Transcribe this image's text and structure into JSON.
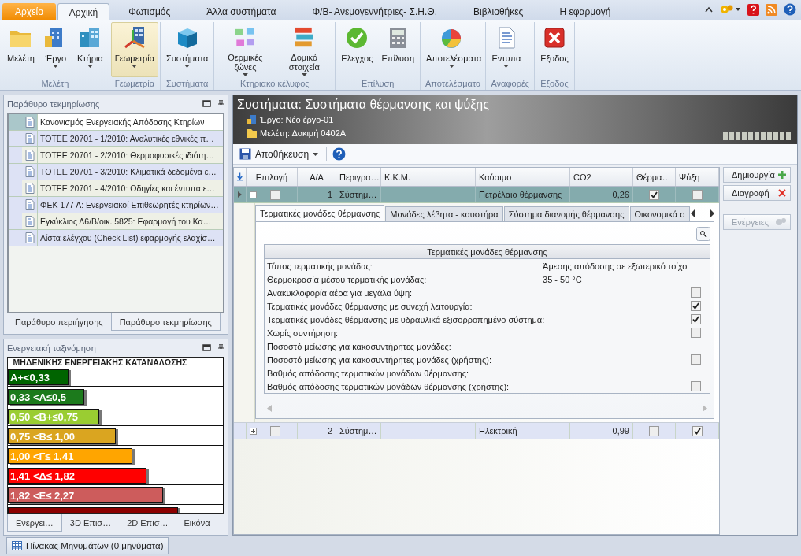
{
  "menu_tabs": [
    {
      "label": "Αρχείο",
      "kind": "app",
      "selected": false
    },
    {
      "label": "Αρχική",
      "kind": "tab",
      "selected": true
    },
    {
      "label": "Φωτισμός",
      "kind": "tab",
      "selected": false
    },
    {
      "label": "Άλλα συστήματα",
      "kind": "tab",
      "selected": false
    },
    {
      "label": "Φ/Β- Ανεμογεννήτριες- Σ.Η.Θ.",
      "kind": "tab",
      "selected": false
    },
    {
      "label": "Βιβλιοθήκες",
      "kind": "tab",
      "selected": false
    },
    {
      "label": "Η εφαρμογή",
      "kind": "tab",
      "selected": false
    }
  ],
  "ribbon": {
    "groups": [
      {
        "label": "Μελέτη",
        "buttons": [
          {
            "label": "Μελέτη",
            "dropdown": false,
            "selected": false
          },
          {
            "label": "Έργο",
            "dropdown": true,
            "selected": false
          },
          {
            "label": "Κτήρια",
            "dropdown": true,
            "selected": false
          }
        ]
      },
      {
        "label": "Γεωμετρία",
        "buttons": [
          {
            "label": "Γεωμετρία",
            "dropdown": true,
            "selected": true
          }
        ]
      },
      {
        "label": "Συστήματα",
        "buttons": [
          {
            "label": "Συστήματα",
            "dropdown": true,
            "selected": false
          }
        ]
      },
      {
        "label": "Κτηριακό κέλυφος",
        "buttons": [
          {
            "label": "Θερμικές ζώνες",
            "dropdown": true,
            "selected": false
          },
          {
            "label": "Δομικά στοιχεία",
            "dropdown": true,
            "selected": false
          }
        ]
      },
      {
        "label": "Επίλυση",
        "buttons": [
          {
            "label": "Ελεγχος",
            "dropdown": false,
            "selected": false
          },
          {
            "label": "Επίλυση",
            "dropdown": false,
            "selected": false
          }
        ]
      },
      {
        "label": "Αποτελέσματα",
        "buttons": [
          {
            "label": "Αποτελέσματα",
            "dropdown": true,
            "selected": false
          }
        ]
      },
      {
        "label": "Αναφορές",
        "buttons": [
          {
            "label": "Εντυπα",
            "dropdown": true,
            "selected": false
          }
        ]
      },
      {
        "label": "Εξοδος",
        "buttons": [
          {
            "label": "Εξοδος",
            "dropdown": false,
            "selected": false
          }
        ]
      }
    ]
  },
  "doc_panel": {
    "title": "Παράθυρο τεκμηρίωσης",
    "items": [
      {
        "text": "Κανονισμός Ενεργειακής Απόδοσης Κτηρίων",
        "selected": true
      },
      {
        "text": "ΤΟΤΕΕ 20701 - 1/2010: Αναλυτικές εθνικές π…",
        "selected": false
      },
      {
        "text": "ΤΟΤΕΕ 20701 - 2/2010: Θερμοφυσικές ιδιότη…",
        "selected": false
      },
      {
        "text": "ΤΟΤΕΕ 20701 - 3/2010: Κλιματικά δεδομένα ε…",
        "selected": false
      },
      {
        "text": "ΤΟΤΕΕ 20701 - 4/2010: Οδηγίες και έντυπα ε…",
        "selected": false
      },
      {
        "text": "ΦΕΚ 177 Α: Ενεργειακοί Επιθεωρητές κτηρίων…",
        "selected": false
      },
      {
        "text": "Εγκύκλιος Δ6/Β/οικ. 5825: Εφαρμογή του Κα…",
        "selected": false
      },
      {
        "text": "Λίστα ελέγχου (Check List) εφαρμογής ελαχίσ…",
        "selected": false
      }
    ],
    "tabs": [
      {
        "label": "Παράθυρο περιήγησης",
        "selected": false
      },
      {
        "label": "Παράθυρο τεκμηρίωσης",
        "selected": true
      }
    ]
  },
  "energy_panel": {
    "title": "Ενεργειακή ταξινόμηση",
    "header": "ΜΗΔΕΝΙΚΗΣ ΕΝΕΡΓΕΙΑΚΗΣ ΚΑΤΑΝΑΛΩΣΗΣ",
    "bands": [
      {
        "label": "Α+<0,33",
        "color": "#006400",
        "level": 0.33
      },
      {
        "label": "0,33 <Α≤0,5",
        "color": "#1c7a1c",
        "level": 0.42
      },
      {
        "label": "0,50 <Β+≤0,75",
        "color": "#9acd32",
        "level": 0.5
      },
      {
        "label": "0,75 <Β≤ 1,00",
        "color": "#daa520",
        "level": 0.59
      },
      {
        "label": "1,00 <Γ≤ 1,41",
        "color": "#ffa500",
        "level": 0.68
      },
      {
        "label": "1,41 <Δ≤ 1,82",
        "color": "#ff0000",
        "level": 0.76
      },
      {
        "label": "1,82 <Ε≤ 2,27",
        "color": "#cd5c5c",
        "level": 0.85
      },
      {
        "color": "#8b0000",
        "level": 0.93
      }
    ],
    "tabs": [
      {
        "label": "Ενεργει…",
        "selected": true
      },
      {
        "label": "3D Επισ…",
        "selected": false
      },
      {
        "label": "2D Επισ…",
        "selected": false
      },
      {
        "label": "Εικόνα",
        "selected": false
      }
    ]
  },
  "main": {
    "title": "Συστήματα: Συστήματα θέρμανσης και ψύξης",
    "project": "Έργο: Νέο έργο-01",
    "study": "Μελέτη: Δοκιμή 0402A",
    "save_label": "Αποθήκευση",
    "columns": [
      "Επιλογή",
      "Α/Α",
      "Περιγρα…",
      "Κ.Κ.Μ.",
      "Καύσιμο",
      "CO2",
      "Θέρμα…",
      "Ψύξη"
    ],
    "rows": [
      {
        "selected": true,
        "expanded": true,
        "checked": false,
        "number": "1",
        "description": "Σύστημ…",
        "fuel": "Πετρέλαιο θέρμανσης",
        "co2": "0,26",
        "heating": true,
        "cooling": false
      },
      {
        "selected": false,
        "expanded": false,
        "checked": false,
        "number": "2",
        "description": "Σύστημ…",
        "fuel": "Ηλεκτρική",
        "co2": "0,99",
        "heating": false,
        "cooling": true
      }
    ],
    "detail": {
      "tabs": [
        {
          "label": "Τερματικές μονάδες θέρμανσης",
          "selected": true
        },
        {
          "label": "Μονάδες λέβητα - καυστήρα",
          "selected": false
        },
        {
          "label": "Σύστημα διανομής θέρμανσης",
          "selected": false
        },
        {
          "label": "Οικονομικά σ",
          "selected": false
        }
      ],
      "section_title": "Τερματικές μονάδες θέρμανσης",
      "properties": [
        {
          "kind": "text",
          "label": "Τύπος τερματικής μονάδας:",
          "value": "Άμεσης απόδοσης σε εξωτερικό τοίχο"
        },
        {
          "kind": "text",
          "label": "Θερμοκρασία μέσου τερματικής μονάδας:",
          "value": "35 - 50 °C"
        },
        {
          "kind": "check",
          "label": "Ανακυκλοφορία αέρα για μεγάλα ύψη:",
          "checked": false
        },
        {
          "kind": "check",
          "label": "Τερματικές μονάδες θέρμανσης με συνεχή λειτουργία:",
          "checked": true
        },
        {
          "kind": "check",
          "label": "Τερματικές μονάδες θέρμανσης με υδραυλικά εξισορροπημένο σύστημα:",
          "checked": true
        },
        {
          "kind": "check",
          "label": "Χωρίς συντήρηση:",
          "checked": false
        },
        {
          "kind": "label",
          "label": "Ποσοστό μείωσης για κακοσυντήρητες μονάδες:"
        },
        {
          "kind": "check",
          "label": "Ποσοστό μείωσης για κακοσυντήρητες μονάδες (χρήστης):",
          "checked": false
        },
        {
          "kind": "label",
          "label": "Βαθμός απόδοσης τερματικών μονάδων θέρμανσης:"
        },
        {
          "kind": "check",
          "label": "Βαθμός απόδοσης τερματικών μονάδων θέρμανσης (χρήστης):",
          "checked": false
        }
      ]
    },
    "side_buttons": [
      {
        "label": "Δημιουργία",
        "disabled": false
      },
      {
        "label": "Διαγραφή",
        "disabled": false
      },
      {
        "label": "Ενέργειες",
        "disabled": true
      }
    ]
  },
  "status_bar": {
    "button": "Πίνακας Μηνυμάτων (0 μηνύματα)"
  }
}
